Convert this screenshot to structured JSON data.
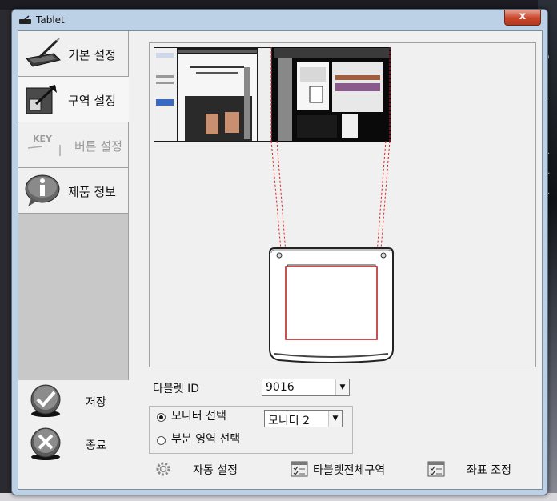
{
  "window": {
    "title": "Tablet",
    "close_label": "x"
  },
  "sidebar": {
    "items": [
      {
        "label": "기본 설정",
        "icon": "tablet-pen-icon",
        "active": false
      },
      {
        "label": "구역 설정",
        "icon": "area-arrow-icon",
        "active": true
      },
      {
        "label": "버튼 설정",
        "icon": "key-icon",
        "active": false,
        "disabled": true,
        "icon_text": "KEY"
      },
      {
        "label": "제품 정보",
        "icon": "info-bubble-icon",
        "active": false
      }
    ]
  },
  "actions": {
    "save_label": "저장",
    "exit_label": "종료"
  },
  "form": {
    "tablet_id_label": "타블렛 ID",
    "tablet_id_value": "9016",
    "monitor_select_label": "모니터 선택",
    "monitor_value": "모니터 2",
    "partial_area_label": "부분 영역 선택",
    "selected_mode": "monitor"
  },
  "toolbar": {
    "auto_setup_label": "자동 설정",
    "full_area_label": "타블렛전체구역",
    "coord_adjust_label": "좌표 조정"
  },
  "colors": {
    "mapping_line": "#cc2222",
    "tablet_area": "#b01818",
    "window_frame": "#bcd0e6"
  }
}
